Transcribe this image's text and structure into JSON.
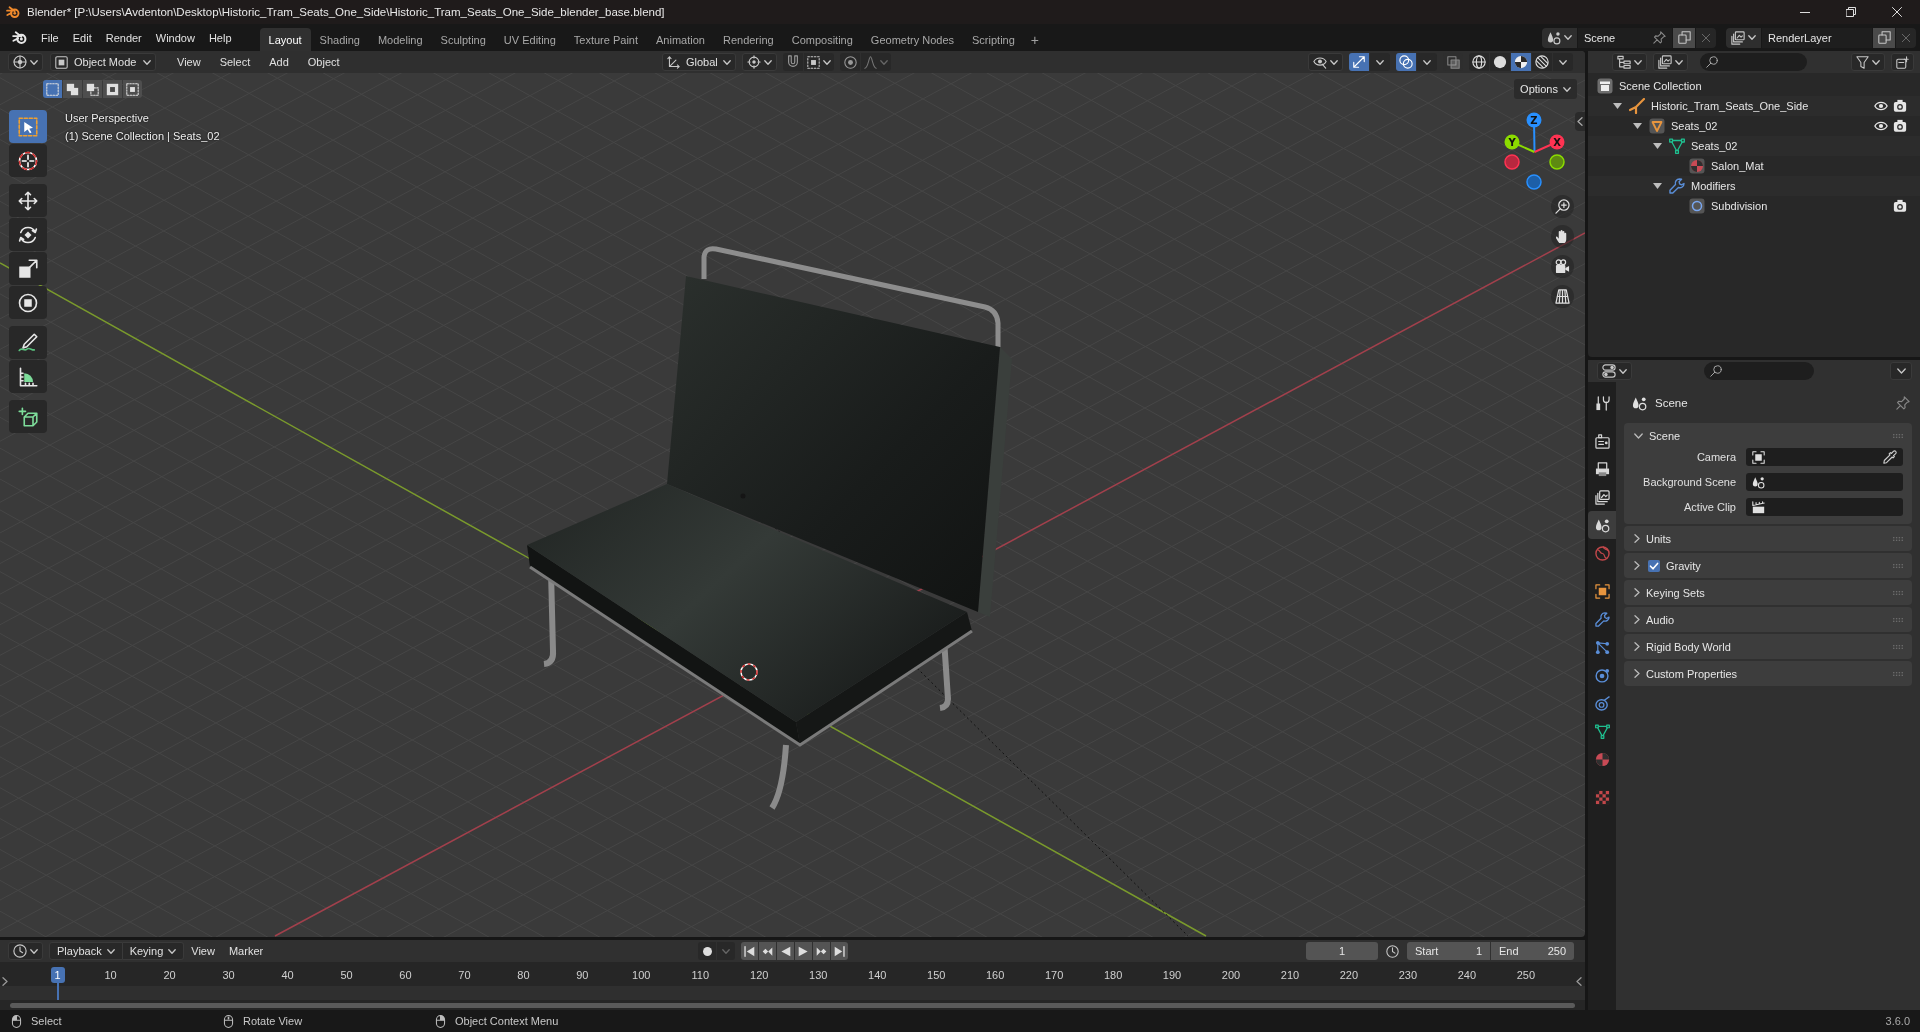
{
  "title_bar": {
    "title": "Blender* [P:\\Users\\Avdenton\\Desktop\\Historic_Tram_Seats_One_Side\\Historic_Tram_Seats_One_Side_blender_base.blend]"
  },
  "top_bar": {
    "menus": [
      "File",
      "Edit",
      "Render",
      "Window",
      "Help"
    ],
    "workspaces": [
      {
        "label": "Layout",
        "selected": true
      },
      {
        "label": "Shading",
        "selected": false
      },
      {
        "label": "Modeling",
        "selected": false
      },
      {
        "label": "Sculpting",
        "selected": false
      },
      {
        "label": "UV Editing",
        "selected": false
      },
      {
        "label": "Texture Paint",
        "selected": false
      },
      {
        "label": "Animation",
        "selected": false
      },
      {
        "label": "Rendering",
        "selected": false
      },
      {
        "label": "Compositing",
        "selected": false
      },
      {
        "label": "Geometry Nodes",
        "selected": false
      },
      {
        "label": "Scripting",
        "selected": false
      }
    ],
    "add_workspace": "+",
    "scene": "Scene",
    "view_layer": "RenderLayer"
  },
  "viewport": {
    "mode": "Object Mode",
    "menus": [
      "View",
      "Select",
      "Add",
      "Object"
    ],
    "orientation": "Global",
    "gizmos_on": true,
    "overlays_on": true,
    "shading_modes": [
      {
        "kind": "wireframe",
        "selected": false
      },
      {
        "kind": "solid",
        "selected": false
      },
      {
        "kind": "material",
        "selected": true
      },
      {
        "kind": "rendered",
        "selected": false
      }
    ],
    "options": "Options",
    "select_modes": [
      {
        "kind": "set",
        "selected": true
      },
      {
        "kind": "extend",
        "selected": false
      },
      {
        "kind": "subtract",
        "selected": false
      },
      {
        "kind": "invert",
        "selected": false
      },
      {
        "kind": "intersect",
        "selected": false
      }
    ],
    "tool_groups": [
      {
        "tools": [
          {
            "kind": "select",
            "selected": true
          },
          {
            "kind": "cursor",
            "selected": false
          }
        ]
      },
      {
        "tools": [
          {
            "kind": "move",
            "selected": false
          },
          {
            "kind": "rotate",
            "selected": false
          },
          {
            "kind": "scale",
            "selected": false
          },
          {
            "kind": "transform",
            "selected": false
          }
        ]
      },
      {
        "tools": [
          {
            "kind": "annotate",
            "selected": false
          },
          {
            "kind": "measure",
            "selected": false
          }
        ]
      },
      {
        "tools": [
          {
            "kind": "add-cube",
            "selected": false
          }
        ]
      }
    ],
    "info": [
      "User Perspective",
      "(1) Scene Collection | Seats_02"
    ],
    "gizmo_axes": [
      "X",
      "Y",
      "Z"
    ]
  },
  "outliner": {
    "root": "Scene Collection",
    "items": [
      {
        "name": "Historic_Tram_Seats_One_Side",
        "kind": "empty",
        "expanded": true,
        "viewport_toggle": true,
        "render_toggle": true,
        "children": [
          {
            "name": "Seats_02",
            "kind": "object",
            "expanded": true,
            "viewport_toggle": true,
            "render_toggle": true,
            "children": [
              {
                "name": "Seats_02",
                "kind": "mesh",
                "expanded": true,
                "viewport_toggle": false,
                "render_toggle": false,
                "children": [
                  {
                    "name": "Salon_Mat",
                    "kind": "material",
                    "viewport_toggle": false,
                    "render_toggle": false
                  }
                ]
              },
              {
                "name": "Modifiers",
                "kind": "modifiers",
                "expanded": true,
                "viewport_toggle": false,
                "render_toggle": false,
                "children": [
                  {
                    "name": "Subdivision",
                    "kind": "subdivision",
                    "viewport_toggle": false,
                    "render_toggle": true
                  }
                ]
              }
            ]
          }
        ]
      }
    ]
  },
  "properties": {
    "tab_groups": [
      {
        "tabs": [
          {
            "kind": "tool",
            "selected": false
          }
        ]
      },
      {
        "tabs": [
          {
            "kind": "render",
            "selected": false
          },
          {
            "kind": "output",
            "selected": false
          },
          {
            "kind": "view-layer",
            "selected": false
          },
          {
            "kind": "scene",
            "selected": true
          },
          {
            "kind": "world",
            "selected": false
          }
        ]
      },
      {
        "tabs": [
          {
            "kind": "object",
            "selected": false
          },
          {
            "kind": "modifiers",
            "selected": false
          },
          {
            "kind": "particles",
            "selected": false
          },
          {
            "kind": "physics",
            "selected": false
          },
          {
            "kind": "constraints",
            "selected": false
          },
          {
            "kind": "data",
            "selected": false
          },
          {
            "kind": "material",
            "selected": false
          }
        ]
      },
      {
        "tabs": [
          {
            "kind": "texture",
            "selected": false
          }
        ]
      }
    ],
    "context": "Scene",
    "panels": [
      {
        "title": "Scene",
        "kind": "plain",
        "expanded": true,
        "fields": [
          {
            "label": "Camera",
            "kind": "camera"
          },
          {
            "label": "Background Scene",
            "kind": "scene"
          },
          {
            "label": "Active Clip",
            "kind": "clip"
          }
        ]
      },
      {
        "title": "Units",
        "kind": "plain",
        "expanded": false
      },
      {
        "title": "Gravity",
        "kind": "checkbox",
        "checked": true,
        "expanded": false
      },
      {
        "title": "Keying Sets",
        "kind": "plain",
        "expanded": false
      },
      {
        "title": "Audio",
        "kind": "plain",
        "expanded": false
      },
      {
        "title": "Rigid Body World",
        "kind": "plain",
        "expanded": false
      },
      {
        "title": "Custom Properties",
        "kind": "plain",
        "expanded": false
      }
    ]
  },
  "timeline": {
    "menus": [
      {
        "label": "Playback",
        "dropdown": true
      },
      {
        "label": "Keying",
        "dropdown": true
      },
      {
        "label": "View",
        "dropdown": false
      },
      {
        "label": "Marker",
        "dropdown": false
      }
    ],
    "current_frame": "1",
    "start_label": "Start",
    "start": "1",
    "end_label": "End",
    "end": "250",
    "playhead": "1",
    "ruler": [
      "10",
      "20",
      "30",
      "40",
      "50",
      "60",
      "70",
      "80",
      "90",
      "100",
      "110",
      "120",
      "130",
      "140",
      "150",
      "160",
      "170",
      "180",
      "190",
      "200",
      "210",
      "220",
      "230",
      "240",
      "250"
    ]
  },
  "status_bar": {
    "hints": [
      {
        "kind": "left",
        "label": "Select"
      },
      {
        "kind": "middle",
        "label": "Rotate View"
      },
      {
        "kind": "right",
        "label": "Object Context Menu"
      }
    ],
    "version": "3.6.0"
  }
}
